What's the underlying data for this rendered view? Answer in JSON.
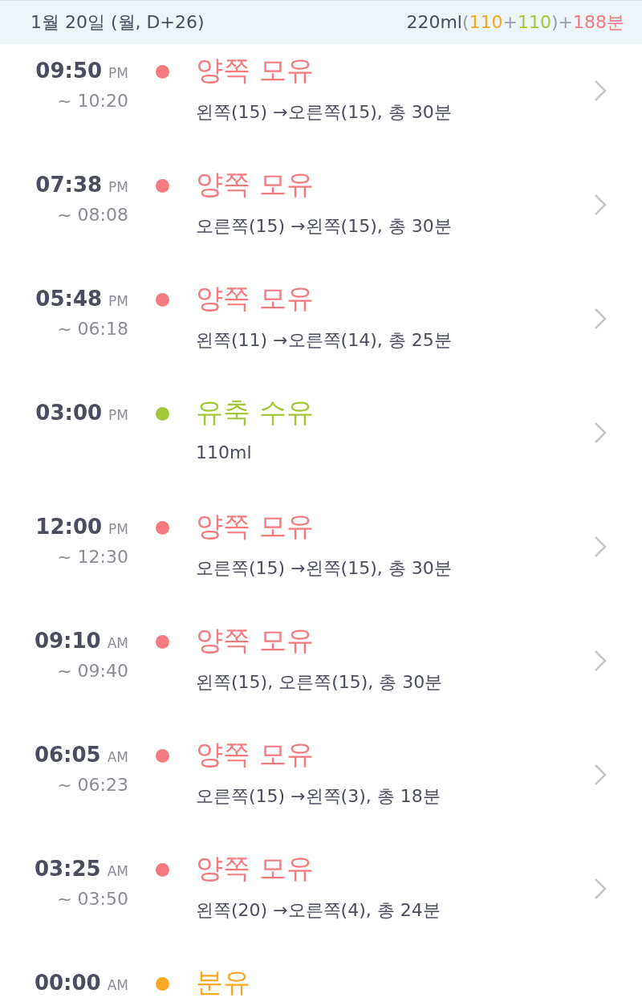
{
  "header": {
    "date": "1월 20일 (월, D+26)",
    "summary": [
      {
        "text": "220ml",
        "color": "#4a4d5e"
      },
      {
        "text": "(",
        "color": "#9a9ca5"
      },
      {
        "text": "110",
        "color": "#f5a623"
      },
      {
        "text": "+",
        "color": "#9a9ca5"
      },
      {
        "text": "110",
        "color": "#a4c639"
      },
      {
        "text": ")",
        "color": "#9a9ca5"
      },
      {
        "text": "+",
        "color": "#9a9ca5"
      },
      {
        "text": "188분",
        "color": "#f07a80"
      }
    ]
  },
  "entries": [
    {
      "time": "09:50",
      "ampm": "PM",
      "end": "~ 10:20",
      "title": "양쪽 모유",
      "color": "#f47a80",
      "detail": "왼쪽(15) →오른쪽(15), 총 30분"
    },
    {
      "time": "07:38",
      "ampm": "PM",
      "end": "~ 08:08",
      "title": "양쪽 모유",
      "color": "#f47a80",
      "detail": "오른쪽(15) →왼쪽(15), 총 30분"
    },
    {
      "time": "05:48",
      "ampm": "PM",
      "end": "~ 06:18",
      "title": "양쪽 모유",
      "color": "#f47a80",
      "detail": "왼쪽(11) →오른쪽(14), 총 25분"
    },
    {
      "time": "03:00",
      "ampm": "PM",
      "title": "유축 수유",
      "color": "#a4c639",
      "detail": "110ml"
    },
    {
      "time": "12:00",
      "ampm": "PM",
      "end": "~ 12:30",
      "title": "양쪽 모유",
      "color": "#f47a80",
      "detail": "오른쪽(15) →왼쪽(15), 총 30분"
    },
    {
      "time": "09:10",
      "ampm": "AM",
      "end": "~ 09:40",
      "title": "양쪽 모유",
      "color": "#f47a80",
      "detail": "왼쪽(15), 오른쪽(15), 총 30분"
    },
    {
      "time": "06:05",
      "ampm": "AM",
      "end": "~ 06:23",
      "title": "양쪽 모유",
      "color": "#f47a80",
      "detail": "오른쪽(15) →왼쪽(3), 총 18분"
    },
    {
      "time": "03:25",
      "ampm": "AM",
      "end": "~ 03:50",
      "title": "양쪽 모유",
      "color": "#f47a80",
      "detail": "왼쪽(20) →오른쪽(4), 총 24분"
    },
    {
      "time": "00:00",
      "ampm": "AM",
      "title": "분유",
      "color": "#f9a825"
    }
  ]
}
